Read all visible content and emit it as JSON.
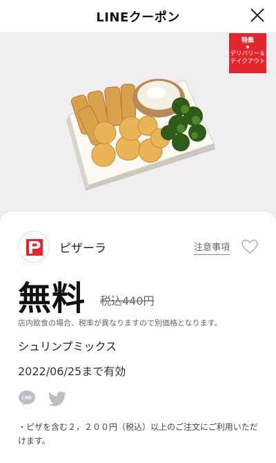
{
  "header": {
    "title": "LINEクーポン",
    "close_icon": "close-icon"
  },
  "badge": {
    "line1": "特集",
    "line2": "デリバリー＆",
    "line3": "テイクアウト",
    "color": "#e3262e"
  },
  "shop": {
    "name": "ピザーラ",
    "notice_label": "注意事項",
    "logo_color": "#e3262e"
  },
  "price": {
    "free_label": "無料",
    "original": "税込440円"
  },
  "note": "店内飲食の場合、税率が異なりますので別価格となります。",
  "item_name": "シュリンプミックス",
  "valid_until": "2022/06/25まで有効",
  "share": {
    "line_label": "LINE",
    "twitter_icon": "twitter-icon"
  },
  "conditions": "・ピザを含む２，２００円（税込）以上のご注文にご利用いただけます。"
}
